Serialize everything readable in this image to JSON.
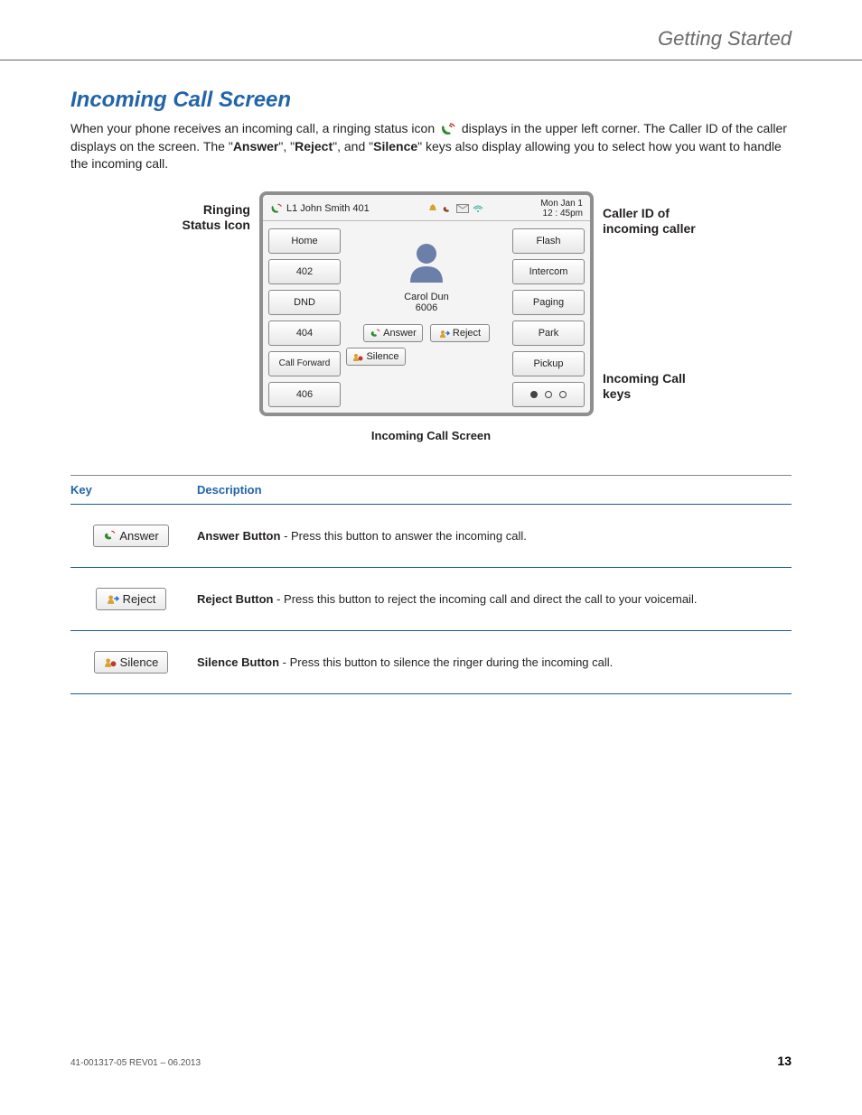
{
  "page_header": "Getting Started",
  "section_title": "Incoming Call Screen",
  "intro": {
    "before_icon": "When your phone receives an incoming call, a ringing status icon ",
    "after_icon": " displays in the upper left corner. The Caller ID of the caller displays on the screen. The \"",
    "answer": "Answer",
    "mid1": "\", \"",
    "reject": "Reject",
    "mid2": "\", and \"",
    "silence": "Silence",
    "after": "\" keys also display allowing you to select how you want to handle the incoming call."
  },
  "diagram": {
    "callout_left_line1": "Ringing",
    "callout_left_line2": "Status Icon",
    "callout_right_1_line1": "Caller ID of",
    "callout_right_1_line2": "incoming caller",
    "callout_right_2_line1": "Incoming Call",
    "callout_right_2_line2": "keys",
    "status_line": "L1 John Smith 401",
    "date_line1": "Mon Jan 1",
    "date_line2": "12 : 45pm",
    "caller_name": "Carol Dun",
    "caller_ext": "6006",
    "left_softkeys": [
      "Home",
      "402",
      "DND",
      "404",
      "Call Forward",
      "406"
    ],
    "right_softkeys": [
      "Flash",
      "Intercom",
      "Paging",
      "Park",
      "Pickup"
    ],
    "action_keys": [
      "Answer",
      "Reject",
      "Silence"
    ]
  },
  "figure_caption": "Incoming Call Screen",
  "table": {
    "headers": [
      "Key",
      "Description"
    ],
    "rows": [
      {
        "key": "Answer",
        "icon": "answer",
        "desc_bold": "Answer Button",
        "desc_rest": " - Press this button to answer the incoming call."
      },
      {
        "key": "Reject",
        "icon": "reject",
        "desc_bold": "Reject Button",
        "desc_rest": " - Press this button to reject the incoming call and direct the call to your voicemail."
      },
      {
        "key": "Silence",
        "icon": "silence",
        "desc_bold": "Silence Button",
        "desc_rest": " - Press this button to silence the ringer during the incoming call."
      }
    ]
  },
  "footer": {
    "doc_id": "41-001317-05 REV01 – 06.2013",
    "page_number": "13"
  }
}
